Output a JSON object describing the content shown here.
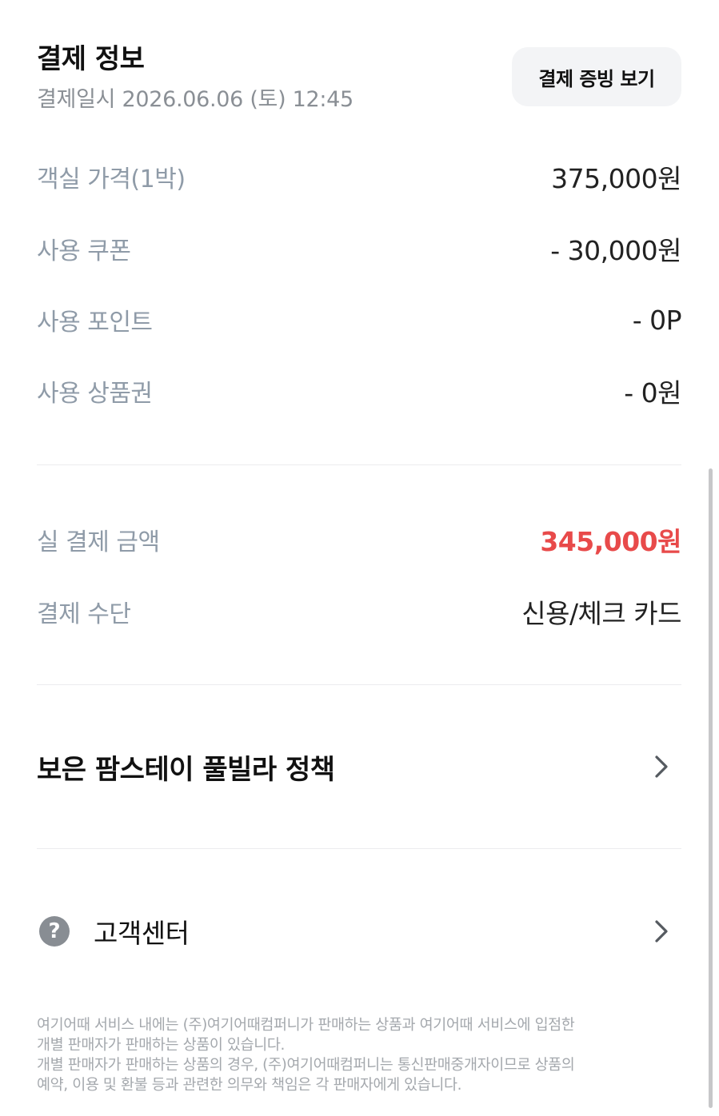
{
  "header": {
    "title": "결제 정보",
    "datetime": "결제일시 2026.06.06 (토) 12:45",
    "receipt_button": "결제 증빙 보기"
  },
  "price_rows": [
    {
      "label": "객실 가격(1박)",
      "value": "375,000원"
    },
    {
      "label": "사용 쿠폰",
      "value": "- 30,000원"
    },
    {
      "label": "사용 포인트",
      "value": "- 0P"
    },
    {
      "label": "사용 상품권",
      "value": "- 0원"
    }
  ],
  "payment": {
    "total_label": "실 결제 금액",
    "total_value": "345,000원",
    "total_color": "#e84a4a",
    "method_label": "결제 수단",
    "method_value": "신용/체크 카드"
  },
  "policy": {
    "title": "보은 팜스테이 풀빌라 정책",
    "icon": "chevron-right-icon"
  },
  "support": {
    "label": "고객센터",
    "icon": "question-circle-icon",
    "icon_glyph": "?"
  },
  "footer": {
    "line1": "여기어때 서비스 내에는 (주)여기어때컴퍼니가 판매하는 상품과 여기어때 서비스에 입점한",
    "line2": "개별 판매자가 판매하는 상품이 있습니다.",
    "line3": "개별 판매자가 판매하는 상품의 경우, (주)여기어때컴퍼니는 통신판매중개자이므로 상품의",
    "line4": "예약, 이용 및 환불 등과 관련한 의무와 책임은 각 판매자에게 있습니다."
  }
}
